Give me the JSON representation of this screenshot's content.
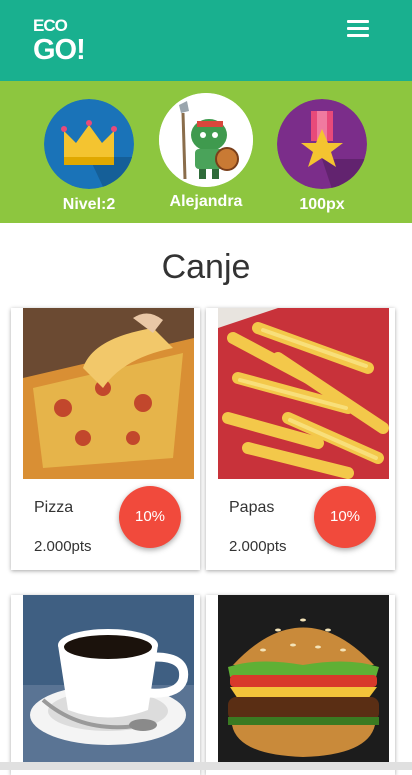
{
  "app": {
    "logo_line1": "ECO",
    "logo_line2": "GO!"
  },
  "profile": {
    "level_label": "Nivel:2",
    "user_name": "Alejandra",
    "points_label": "100px"
  },
  "page": {
    "title": "Canje"
  },
  "rewards": [
    {
      "name": "Pizza",
      "points": "2.000pts",
      "discount": "10%"
    },
    {
      "name": "Papas",
      "points": "2.000pts",
      "discount": "10%"
    },
    {
      "name": "",
      "points": "",
      "discount": ""
    },
    {
      "name": "",
      "points": "",
      "discount": ""
    }
  ],
  "colors": {
    "header": "#19b08f",
    "profile_band": "#8dc63f",
    "discount_badge": "#f14a3c"
  }
}
